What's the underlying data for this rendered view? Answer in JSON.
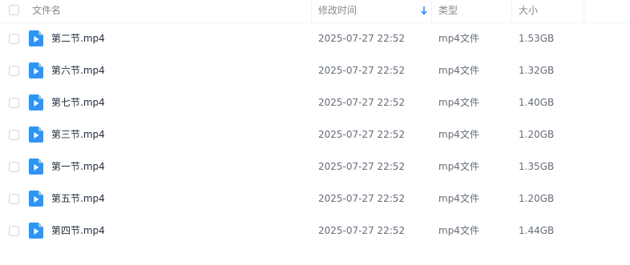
{
  "header": {
    "name_label": "文件名",
    "modified_label": "修改时间",
    "type_label": "类型",
    "size_label": "大小",
    "sort_icon": "arrow-down-icon"
  },
  "colors": {
    "accent": "#2c8ef8",
    "file_icon": "#2c95f6",
    "text": "#424e67",
    "header_text": "#888888"
  },
  "files": [
    {
      "name": "第二节.mp4",
      "modified": "2025-07-27 22:52",
      "type": "mp4文件",
      "size": "1.53GB",
      "icon": "video-file-icon"
    },
    {
      "name": "第六节.mp4",
      "modified": "2025-07-27 22:52",
      "type": "mp4文件",
      "size": "1.32GB",
      "icon": "video-file-icon"
    },
    {
      "name": "第七节.mp4",
      "modified": "2025-07-27 22:52",
      "type": "mp4文件",
      "size": "1.40GB",
      "icon": "video-file-icon"
    },
    {
      "name": "第三节.mp4",
      "modified": "2025-07-27 22:52",
      "type": "mp4文件",
      "size": "1.20GB",
      "icon": "video-file-icon"
    },
    {
      "name": "第一节.mp4",
      "modified": "2025-07-27 22:52",
      "type": "mp4文件",
      "size": "1.35GB",
      "icon": "video-file-icon"
    },
    {
      "name": "第五节.mp4",
      "modified": "2025-07-27 22:52",
      "type": "mp4文件",
      "size": "1.20GB",
      "icon": "video-file-icon"
    },
    {
      "name": "第四节.mp4",
      "modified": "2025-07-27 22:52",
      "type": "mp4文件",
      "size": "1.44GB",
      "icon": "video-file-icon"
    }
  ]
}
